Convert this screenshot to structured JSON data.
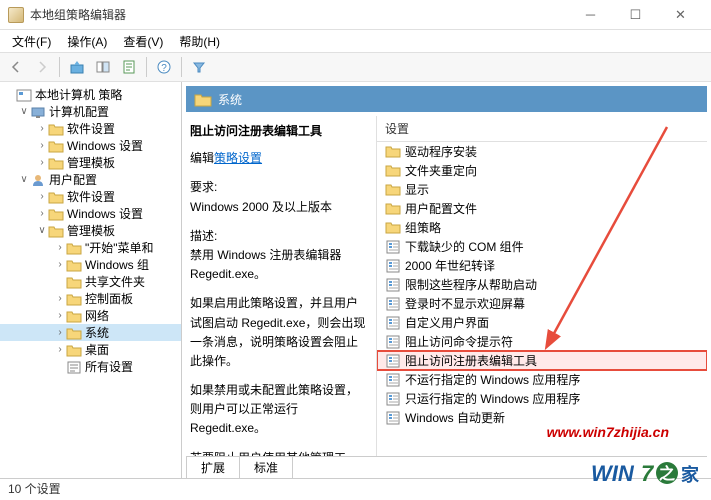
{
  "window": {
    "title": "本地组策略编辑器"
  },
  "menu": {
    "file": "文件(F)",
    "action": "操作(A)",
    "view": "查看(V)",
    "help": "帮助(H)"
  },
  "tree": {
    "root": "本地计算机 策略",
    "computer": "计算机配置",
    "c_software": "软件设置",
    "c_windows": "Windows 设置",
    "c_templates": "管理模板",
    "user": "用户配置",
    "u_software": "软件设置",
    "u_windows": "Windows 设置",
    "u_templates": "管理模板",
    "start_menu": "\"开始\"菜单和",
    "win_components": "Windows 组",
    "shared_folders": "共享文件夹",
    "control_panel": "控制面板",
    "network": "网络",
    "system": "系统",
    "desktop": "桌面",
    "all_settings": "所有设置"
  },
  "pathbar": {
    "label": "系统"
  },
  "desc": {
    "title": "阻止访问注册表编辑工具",
    "edit_prefix": "编辑",
    "edit_link": "策略设置",
    "req_label": "要求:",
    "req_value": "Windows 2000 及以上版本",
    "desc_label": "描述:",
    "p1": "禁用 Windows 注册表编辑器 Regedit.exe。",
    "p2": "如果启用此策略设置，并且用户试图启动 Regedit.exe，则会出现一条消息，说明策略设置会阻止此操作。",
    "p3": "如果禁用或未配置此策略设置，则用户可以正常运行 Regedit.exe。",
    "p4": "若要阻止用户使用其他管理工具，请使用\"只运行指定的 Windows 应用程序\"策略设置。"
  },
  "list": {
    "header": "设置",
    "items": [
      {
        "label": "驱动程序安装",
        "type": "folder"
      },
      {
        "label": "文件夹重定向",
        "type": "folder"
      },
      {
        "label": "显示",
        "type": "folder"
      },
      {
        "label": "用户配置文件",
        "type": "folder"
      },
      {
        "label": "组策略",
        "type": "folder"
      },
      {
        "label": "下载缺少的 COM 组件",
        "type": "setting"
      },
      {
        "label": "2000 年世纪转译",
        "type": "setting"
      },
      {
        "label": "限制这些程序从帮助启动",
        "type": "setting"
      },
      {
        "label": "登录时不显示欢迎屏幕",
        "type": "setting"
      },
      {
        "label": "自定义用户界面",
        "type": "setting"
      },
      {
        "label": "阻止访问命令提示符",
        "type": "setting"
      },
      {
        "label": "阻止访问注册表编辑工具",
        "type": "setting",
        "highlighted": true
      },
      {
        "label": "不运行指定的 Windows 应用程序",
        "type": "setting"
      },
      {
        "label": "只运行指定的 Windows 应用程序",
        "type": "setting"
      },
      {
        "label": "Windows 自动更新",
        "type": "setting"
      }
    ]
  },
  "tabs": {
    "extended": "扩展",
    "standard": "标准"
  },
  "status": {
    "count": "10 个设置"
  },
  "watermark": {
    "url": "www.win7zhijia.cn"
  }
}
